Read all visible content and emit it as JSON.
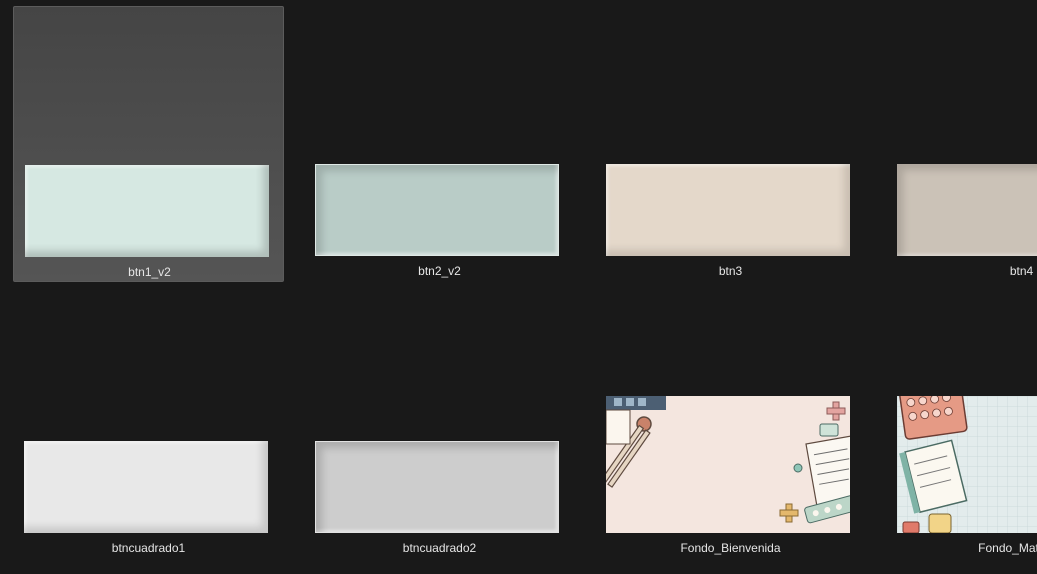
{
  "files": [
    {
      "name": "btn1_v2",
      "selected": true,
      "colors": {
        "face": "#d3e6e0",
        "edge": "#b9cbc5"
      }
    },
    {
      "name": "btn2_v2",
      "selected": false,
      "colors": {
        "face": "#b9ccc7",
        "edge": "#a4b6b1"
      }
    },
    {
      "name": "btn3",
      "selected": false,
      "colors": {
        "face": "#e4d8ca",
        "edge": "#cfc3b5"
      }
    },
    {
      "name": "btn4",
      "selected": false,
      "colors": {
        "face": "#cbc2b7",
        "edge": "#b4aca2"
      }
    },
    {
      "name": "btncuadrado1",
      "selected": false,
      "colors": {
        "face": "#e8e8e8",
        "edge": "#d2d2d2"
      }
    },
    {
      "name": "btncuadrado2",
      "selected": false,
      "colors": {
        "face": "#cdcdcd",
        "edge": "#b8b8b8"
      }
    },
    {
      "name": "Fondo_Bienvenida",
      "selected": false,
      "colors": {
        "face": "#f4e6df"
      }
    },
    {
      "name": "Fondo_Materias",
      "selected": false,
      "colors": {
        "face": "#e3ecec"
      }
    }
  ]
}
